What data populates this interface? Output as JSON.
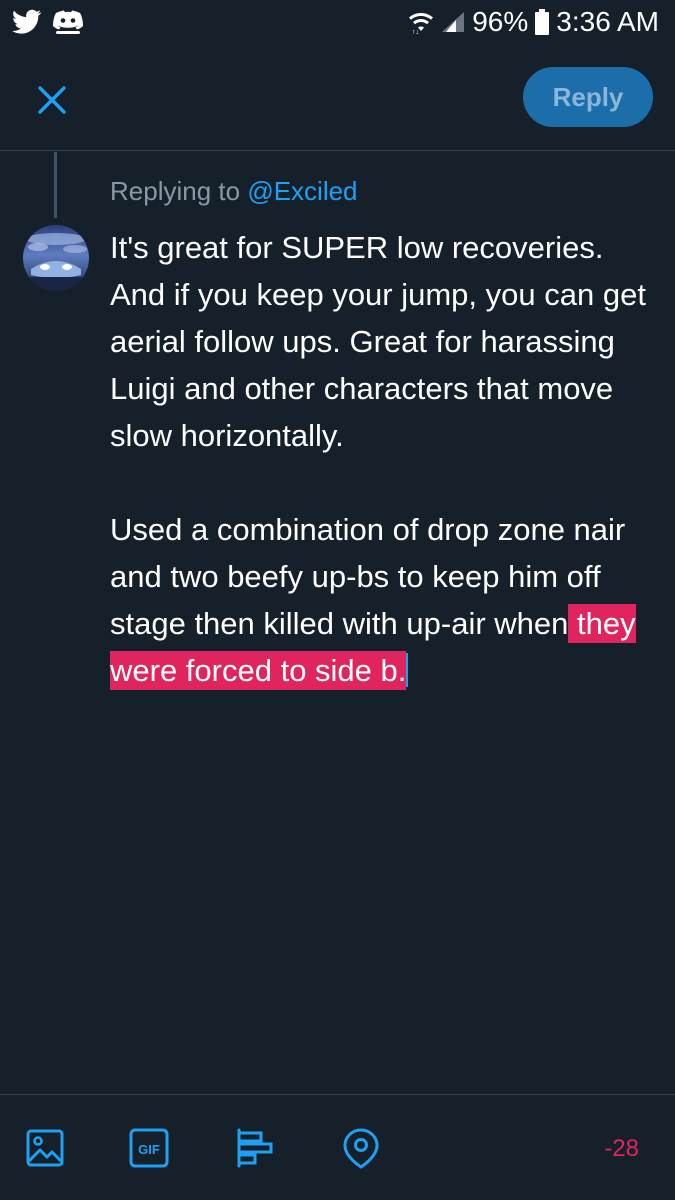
{
  "status_bar": {
    "battery": "96%",
    "time": "3:36 AM",
    "icons": [
      "twitter-bird-icon",
      "discord-icon",
      "wifi-icon",
      "signal-icon",
      "battery-icon"
    ]
  },
  "header": {
    "close_icon": "close-icon",
    "reply_label": "Reply"
  },
  "reply_context": {
    "prefix": "Replying to",
    "handle": "@Exciled"
  },
  "tweet": {
    "line1": "It's great for SUPER low recoveries. And if you keep your jump, you can get aerial follow ups. Great for harassing Luigi and other characters that move slow horizontally.",
    "line2_normal": "Used a combination of drop zone nair and two beefy up-bs to keep him off stage then killed with up-air when",
    "line2_overflow": " they were forced to side b."
  },
  "toolbar": {
    "icons": [
      "image-icon",
      "gif-icon",
      "poll-icon",
      "location-icon"
    ],
    "gif_label": "GIF",
    "char_count": "-28"
  },
  "colors": {
    "background": "#15202b",
    "accent": "#1da1f2",
    "reply_button": "#1c6eab",
    "overflow": "#e0245e",
    "muted_text": "#8899a6"
  }
}
